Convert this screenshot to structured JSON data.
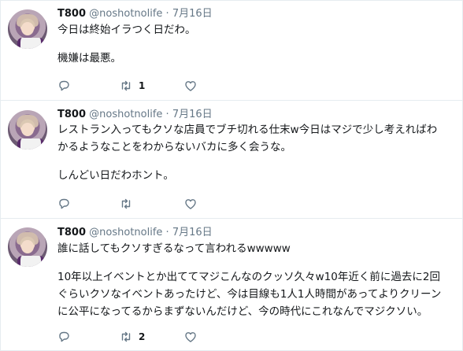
{
  "tweets": [
    {
      "name": "T800",
      "handle": "@noshotnolife",
      "separator": "·",
      "date": "7月16日",
      "paragraphs": [
        "今日は終始イラつく日だわ。",
        "機嫌は最悪。"
      ],
      "retweet_count": "1",
      "reply_count": "",
      "like_count": ""
    },
    {
      "name": "T800",
      "handle": "@noshotnolife",
      "separator": "·",
      "date": "7月16日",
      "paragraphs": [
        "レストラン入ってもクソな店員でブチ切れる仕末w今日はマジで少し考えればわ\nかるようなことをわからないバカに多く会うな。",
        "しんどい日だわホント。"
      ],
      "retweet_count": "",
      "reply_count": "",
      "like_count": ""
    },
    {
      "name": "T800",
      "handle": "@noshotnolife",
      "separator": "·",
      "date": "7月16日",
      "paragraphs": [
        "誰に話してもクソすぎるなって言われるwwwww",
        "10年以上イベントとか出ててマジこんなのクッソ久々w10年近く前に過去に2回\nぐらいクソなイベントあったけど、今は目線も1人1人時間があってよりクリーン\nに公平になってるからまずないんだけど、今の時代にこれなんでマジクソい。"
      ],
      "retweet_count": "2",
      "reply_count": "",
      "like_count": ""
    }
  ],
  "icons": {
    "reply": "reply-icon",
    "retweet": "retweet-icon",
    "like": "heart-icon"
  },
  "colors": {
    "text": "#14171a",
    "muted": "#657786",
    "divider": "#e6ecf0"
  }
}
